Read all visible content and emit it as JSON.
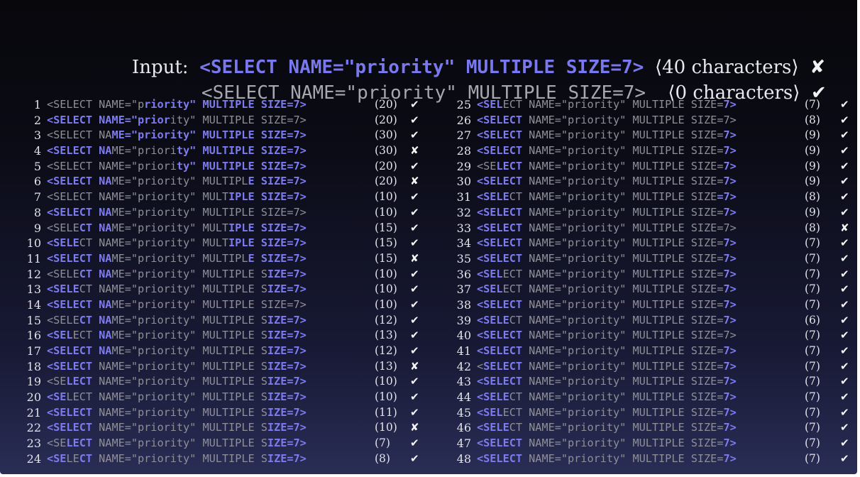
{
  "header": {
    "input_label": "Input:",
    "input_code": "<SELECT NAME=\"priority\" MULTIPLE SIZE=7>",
    "input_count": "⟨40 characters⟩",
    "input_mark": "✘",
    "output_code": "<SELECT NAME=\"priority\" MULTIPLE SIZE=7>",
    "output_count": "⟨0 characters⟩",
    "output_mark": "✔"
  },
  "code_text": "<SELECT NAME=\"priority\" MULTIPLE SIZE=7>",
  "rows": [
    {
      "n": "1",
      "hl": [
        [
          0,
          15,
          0
        ],
        [
          15,
          40,
          1
        ]
      ],
      "count": "(20)",
      "mark": "✔"
    },
    {
      "n": "2",
      "hl": [
        [
          0,
          19,
          1
        ],
        [
          19,
          40,
          0
        ]
      ],
      "count": "(20)",
      "mark": "✔"
    },
    {
      "n": "3",
      "hl": [
        [
          0,
          10,
          0
        ],
        [
          10,
          40,
          1
        ]
      ],
      "count": "(30)",
      "mark": "✔"
    },
    {
      "n": "4",
      "hl": [
        [
          0,
          10,
          1
        ],
        [
          10,
          20,
          0
        ],
        [
          20,
          40,
          1
        ]
      ],
      "count": "(30)",
      "mark": "✘"
    },
    {
      "n": "5",
      "hl": [
        [
          0,
          20,
          0
        ],
        [
          20,
          40,
          1
        ]
      ],
      "count": "(20)",
      "mark": "✔"
    },
    {
      "n": "6",
      "hl": [
        [
          0,
          10,
          1
        ],
        [
          10,
          31,
          0
        ],
        [
          31,
          40,
          1
        ]
      ],
      "count": "(20)",
      "mark": "✘"
    },
    {
      "n": "7",
      "hl": [
        [
          0,
          28,
          0
        ],
        [
          28,
          40,
          1
        ]
      ],
      "count": "(10)",
      "mark": "✔"
    },
    {
      "n": "8",
      "hl": [
        [
          0,
          10,
          1
        ],
        [
          10,
          40,
          0
        ]
      ],
      "count": "(10)",
      "mark": "✔"
    },
    {
      "n": "9",
      "hl": [
        [
          0,
          5,
          0
        ],
        [
          5,
          10,
          1
        ],
        [
          10,
          28,
          0
        ],
        [
          28,
          40,
          1
        ]
      ],
      "count": "(15)",
      "mark": "✔"
    },
    {
      "n": "10",
      "hl": [
        [
          0,
          5,
          1
        ],
        [
          5,
          28,
          0
        ],
        [
          28,
          40,
          1
        ]
      ],
      "count": "(15)",
      "mark": "✔"
    },
    {
      "n": "11",
      "hl": [
        [
          0,
          10,
          1
        ],
        [
          10,
          31,
          0
        ],
        [
          31,
          40,
          1
        ]
      ],
      "count": "(15)",
      "mark": "✘"
    },
    {
      "n": "12",
      "hl": [
        [
          0,
          5,
          0
        ],
        [
          5,
          10,
          1
        ],
        [
          10,
          34,
          0
        ],
        [
          34,
          40,
          1
        ]
      ],
      "count": "(10)",
      "mark": "✔"
    },
    {
      "n": "13",
      "hl": [
        [
          0,
          5,
          1
        ],
        [
          5,
          34,
          0
        ],
        [
          34,
          40,
          1
        ]
      ],
      "count": "(10)",
      "mark": "✔"
    },
    {
      "n": "14",
      "hl": [
        [
          0,
          10,
          1
        ],
        [
          10,
          40,
          0
        ]
      ],
      "count": "(10)",
      "mark": "✔"
    },
    {
      "n": "15",
      "hl": [
        [
          0,
          5,
          0
        ],
        [
          5,
          10,
          1
        ],
        [
          10,
          34,
          0
        ],
        [
          34,
          40,
          1
        ]
      ],
      "count": "(12)",
      "mark": "✔"
    },
    {
      "n": "16",
      "hl": [
        [
          0,
          4,
          1
        ],
        [
          4,
          8,
          0
        ],
        [
          8,
          10,
          1
        ],
        [
          10,
          34,
          0
        ],
        [
          34,
          40,
          1
        ]
      ],
      "count": "(13)",
      "mark": "✔"
    },
    {
      "n": "17",
      "hl": [
        [
          0,
          10,
          1
        ],
        [
          10,
          34,
          0
        ],
        [
          34,
          40,
          1
        ]
      ],
      "count": "(12)",
      "mark": "✔"
    },
    {
      "n": "18",
      "hl": [
        [
          0,
          8,
          1
        ],
        [
          8,
          34,
          0
        ],
        [
          34,
          40,
          1
        ]
      ],
      "count": "(13)",
      "mark": "✘"
    },
    {
      "n": "19",
      "hl": [
        [
          0,
          3,
          0
        ],
        [
          3,
          8,
          1
        ],
        [
          8,
          34,
          0
        ],
        [
          34,
          40,
          1
        ]
      ],
      "count": "(10)",
      "mark": "✔"
    },
    {
      "n": "20",
      "hl": [
        [
          0,
          3,
          1
        ],
        [
          3,
          34,
          0
        ],
        [
          34,
          40,
          1
        ]
      ],
      "count": "(10)",
      "mark": "✔"
    },
    {
      "n": "21",
      "hl": [
        [
          0,
          8,
          1
        ],
        [
          8,
          34,
          0
        ],
        [
          34,
          40,
          1
        ]
      ],
      "count": "(11)",
      "mark": "✔"
    },
    {
      "n": "22",
      "hl": [
        [
          0,
          8,
          1
        ],
        [
          8,
          34,
          0
        ],
        [
          34,
          40,
          1
        ]
      ],
      "count": "(10)",
      "mark": "✘"
    },
    {
      "n": "23",
      "hl": [
        [
          0,
          3,
          0
        ],
        [
          3,
          8,
          1
        ],
        [
          8,
          34,
          0
        ],
        [
          34,
          40,
          1
        ]
      ],
      "count": "(7)",
      "mark": "✔"
    },
    {
      "n": "24",
      "hl": [
        [
          0,
          3,
          1
        ],
        [
          3,
          5,
          0
        ],
        [
          5,
          8,
          1
        ],
        [
          8,
          34,
          0
        ],
        [
          34,
          40,
          1
        ]
      ],
      "count": "(8)",
      "mark": "✔"
    },
    {
      "n": "25",
      "hl": [
        [
          0,
          4,
          1
        ],
        [
          4,
          38,
          0
        ],
        [
          38,
          40,
          1
        ]
      ],
      "count": "(7)",
      "mark": "✔"
    },
    {
      "n": "26",
      "hl": [
        [
          0,
          8,
          1
        ],
        [
          8,
          40,
          0
        ]
      ],
      "count": "(8)",
      "mark": "✔"
    },
    {
      "n": "27",
      "hl": [
        [
          0,
          8,
          1
        ],
        [
          8,
          38,
          0
        ],
        [
          38,
          40,
          1
        ]
      ],
      "count": "(9)",
      "mark": "✔"
    },
    {
      "n": "28",
      "hl": [
        [
          0,
          8,
          1
        ],
        [
          8,
          38,
          0
        ],
        [
          38,
          40,
          1
        ]
      ],
      "count": "(9)",
      "mark": "✔"
    },
    {
      "n": "29",
      "hl": [
        [
          0,
          3,
          0
        ],
        [
          3,
          8,
          1
        ],
        [
          8,
          38,
          0
        ],
        [
          38,
          40,
          1
        ]
      ],
      "count": "(9)",
      "mark": "✔"
    },
    {
      "n": "30",
      "hl": [
        [
          0,
          8,
          1
        ],
        [
          8,
          38,
          0
        ],
        [
          38,
          40,
          1
        ]
      ],
      "count": "(9)",
      "mark": "✔"
    },
    {
      "n": "31",
      "hl": [
        [
          0,
          5,
          1
        ],
        [
          5,
          37,
          0
        ],
        [
          37,
          40,
          1
        ]
      ],
      "count": "(8)",
      "mark": "✔"
    },
    {
      "n": "32",
      "hl": [
        [
          0,
          8,
          1
        ],
        [
          8,
          38,
          0
        ],
        [
          38,
          40,
          1
        ]
      ],
      "count": "(9)",
      "mark": "✔"
    },
    {
      "n": "33",
      "hl": [
        [
          0,
          8,
          1
        ],
        [
          8,
          40,
          0
        ]
      ],
      "count": "(8)",
      "mark": "✘"
    },
    {
      "n": "34",
      "hl": [
        [
          0,
          8,
          1
        ],
        [
          8,
          38,
          0
        ],
        [
          38,
          40,
          1
        ]
      ],
      "count": "(7)",
      "mark": "✔"
    },
    {
      "n": "35",
      "hl": [
        [
          0,
          8,
          1
        ],
        [
          8,
          38,
          0
        ],
        [
          38,
          40,
          1
        ]
      ],
      "count": "(7)",
      "mark": "✔"
    },
    {
      "n": "36",
      "hl": [
        [
          0,
          4,
          1
        ],
        [
          4,
          38,
          0
        ],
        [
          38,
          40,
          1
        ]
      ],
      "count": "(7)",
      "mark": "✔"
    },
    {
      "n": "37",
      "hl": [
        [
          0,
          4,
          1
        ],
        [
          4,
          38,
          0
        ],
        [
          38,
          40,
          1
        ]
      ],
      "count": "(7)",
      "mark": "✔"
    },
    {
      "n": "38",
      "hl": [
        [
          0,
          8,
          1
        ],
        [
          8,
          38,
          0
        ],
        [
          38,
          40,
          1
        ]
      ],
      "count": "(7)",
      "mark": "✔"
    },
    {
      "n": "39",
      "hl": [
        [
          0,
          5,
          1
        ],
        [
          5,
          38,
          0
        ],
        [
          38,
          40,
          1
        ]
      ],
      "count": "(6)",
      "mark": "✔"
    },
    {
      "n": "40",
      "hl": [
        [
          0,
          8,
          1
        ],
        [
          8,
          40,
          0
        ]
      ],
      "count": "(7)",
      "mark": "✔"
    },
    {
      "n": "41",
      "hl": [
        [
          0,
          8,
          1
        ],
        [
          8,
          38,
          0
        ],
        [
          38,
          40,
          1
        ]
      ],
      "count": "(7)",
      "mark": "✔"
    },
    {
      "n": "42",
      "hl": [
        [
          0,
          1,
          0
        ],
        [
          1,
          8,
          1
        ],
        [
          8,
          38,
          0
        ],
        [
          38,
          40,
          1
        ]
      ],
      "count": "(7)",
      "mark": "✔"
    },
    {
      "n": "43",
      "hl": [
        [
          0,
          8,
          1
        ],
        [
          8,
          38,
          0
        ],
        [
          38,
          40,
          1
        ]
      ],
      "count": "(7)",
      "mark": "✔"
    },
    {
      "n": "44",
      "hl": [
        [
          0,
          5,
          1
        ],
        [
          5,
          38,
          0
        ],
        [
          38,
          40,
          1
        ]
      ],
      "count": "(7)",
      "mark": "✔"
    },
    {
      "n": "45",
      "hl": [
        [
          0,
          4,
          1
        ],
        [
          4,
          38,
          0
        ],
        [
          38,
          40,
          1
        ]
      ],
      "count": "(7)",
      "mark": "✔"
    },
    {
      "n": "46",
      "hl": [
        [
          0,
          5,
          1
        ],
        [
          5,
          38,
          0
        ],
        [
          38,
          40,
          1
        ]
      ],
      "count": "(7)",
      "mark": "✔"
    },
    {
      "n": "47",
      "hl": [
        [
          0,
          8,
          1
        ],
        [
          8,
          38,
          0
        ],
        [
          38,
          40,
          1
        ]
      ],
      "count": "(7)",
      "mark": "✔"
    },
    {
      "n": "48",
      "hl": [
        [
          0,
          8,
          1
        ],
        [
          8,
          38,
          0
        ],
        [
          38,
          40,
          1
        ]
      ],
      "count": "(7)",
      "mark": "✔"
    }
  ],
  "colors": {
    "highlight": "#7d7bf0",
    "dim": "#8f8f98",
    "background": "#0b0b15"
  }
}
